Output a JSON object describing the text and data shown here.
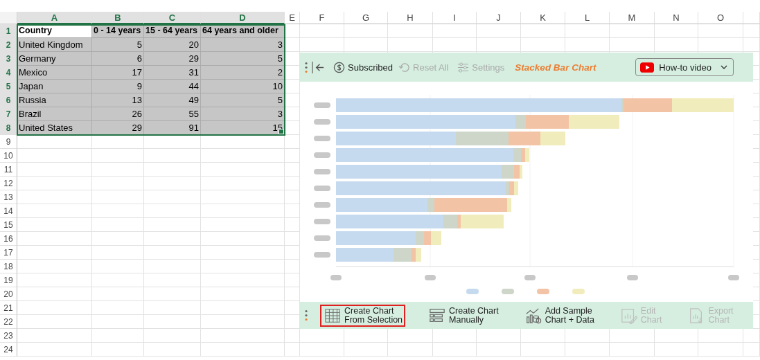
{
  "sheet": {
    "columns": [
      {
        "label": "A",
        "selected": true
      },
      {
        "label": "B",
        "selected": true
      },
      {
        "label": "C",
        "selected": true
      },
      {
        "label": "D",
        "selected": true
      },
      {
        "label": "E",
        "selected": false
      },
      {
        "label": "F",
        "selected": false
      },
      {
        "label": "G",
        "selected": false
      },
      {
        "label": "H",
        "selected": false
      },
      {
        "label": "I",
        "selected": false
      },
      {
        "label": "J",
        "selected": false
      },
      {
        "label": "K",
        "selected": false
      },
      {
        "label": "L",
        "selected": false
      },
      {
        "label": "M",
        "selected": false
      },
      {
        "label": "N",
        "selected": false
      },
      {
        "label": "O",
        "selected": false
      }
    ],
    "rows": [
      {
        "number": "1",
        "selected": true,
        "active": true,
        "kind": "header",
        "cells": [
          "Country",
          "0 - 14 years",
          "15 - 64 years",
          "64 years and older"
        ]
      },
      {
        "number": "2",
        "selected": true,
        "active": false,
        "kind": "data",
        "cells": [
          "United Kingdom",
          "5",
          "20",
          "3"
        ]
      },
      {
        "number": "3",
        "selected": true,
        "active": false,
        "kind": "data",
        "cells": [
          "Germany",
          "6",
          "29",
          "5"
        ]
      },
      {
        "number": "4",
        "selected": true,
        "active": false,
        "kind": "data",
        "cells": [
          "Mexico",
          "17",
          "31",
          "2"
        ]
      },
      {
        "number": "5",
        "selected": true,
        "active": false,
        "kind": "data",
        "cells": [
          "Japan",
          "9",
          "44",
          "10"
        ]
      },
      {
        "number": "6",
        "selected": true,
        "active": false,
        "kind": "data",
        "cells": [
          "Russia",
          "13",
          "49",
          "5"
        ]
      },
      {
        "number": "7",
        "selected": true,
        "active": false,
        "kind": "data",
        "cells": [
          "Brazil",
          "26",
          "55",
          "3"
        ]
      },
      {
        "number": "8",
        "selected": true,
        "active": false,
        "kind": "data",
        "cells": [
          "United States",
          "29",
          "91",
          "15"
        ]
      },
      {
        "number": "9",
        "selected": false,
        "active": false,
        "kind": "empty",
        "cells": []
      },
      {
        "number": "10",
        "selected": false,
        "active": false,
        "kind": "empty",
        "cells": []
      },
      {
        "number": "11",
        "selected": false,
        "active": false,
        "kind": "empty",
        "cells": []
      },
      {
        "number": "12",
        "selected": false,
        "active": false,
        "kind": "empty",
        "cells": []
      },
      {
        "number": "13",
        "selected": false,
        "active": false,
        "kind": "empty",
        "cells": []
      },
      {
        "number": "14",
        "selected": false,
        "active": false,
        "kind": "empty",
        "cells": []
      },
      {
        "number": "15",
        "selected": false,
        "active": false,
        "kind": "empty",
        "cells": []
      },
      {
        "number": "16",
        "selected": false,
        "active": false,
        "kind": "empty",
        "cells": []
      },
      {
        "number": "17",
        "selected": false,
        "active": false,
        "kind": "empty",
        "cells": []
      },
      {
        "number": "18",
        "selected": false,
        "active": false,
        "kind": "empty",
        "cells": []
      },
      {
        "number": "19",
        "selected": false,
        "active": false,
        "kind": "empty",
        "cells": []
      },
      {
        "number": "20",
        "selected": false,
        "active": false,
        "kind": "empty",
        "cells": []
      },
      {
        "number": "21",
        "selected": false,
        "active": false,
        "kind": "empty",
        "cells": []
      },
      {
        "number": "22",
        "selected": false,
        "active": false,
        "kind": "empty",
        "cells": []
      },
      {
        "number": "23",
        "selected": false,
        "active": false,
        "kind": "empty",
        "cells": []
      },
      {
        "number": "24",
        "selected": false,
        "active": false,
        "kind": "empty",
        "cells": []
      }
    ]
  },
  "panel": {
    "top_bar": {
      "subscription": "Subscribed",
      "actions": [
        {
          "label": "Reset All",
          "disabled": true
        },
        {
          "label": "Settings",
          "disabled": true
        }
      ],
      "title": "Stacked Bar Chart",
      "video_button": "How-to video"
    },
    "bottom_bar": [
      {
        "lines": [
          "Create Chart",
          "From Selection"
        ],
        "disabled": false,
        "selected": true
      },
      {
        "lines": [
          "Create Chart",
          "Manually"
        ],
        "disabled": false,
        "selected": false
      },
      {
        "lines": [
          "Add Sample",
          "Chart + Data"
        ],
        "disabled": false,
        "selected": false
      },
      {
        "lines": [
          "Edit",
          "Chart"
        ],
        "disabled": true,
        "selected": false
      },
      {
        "lines": [
          "Export",
          "Chart"
        ],
        "disabled": true,
        "selected": false
      }
    ]
  }
}
